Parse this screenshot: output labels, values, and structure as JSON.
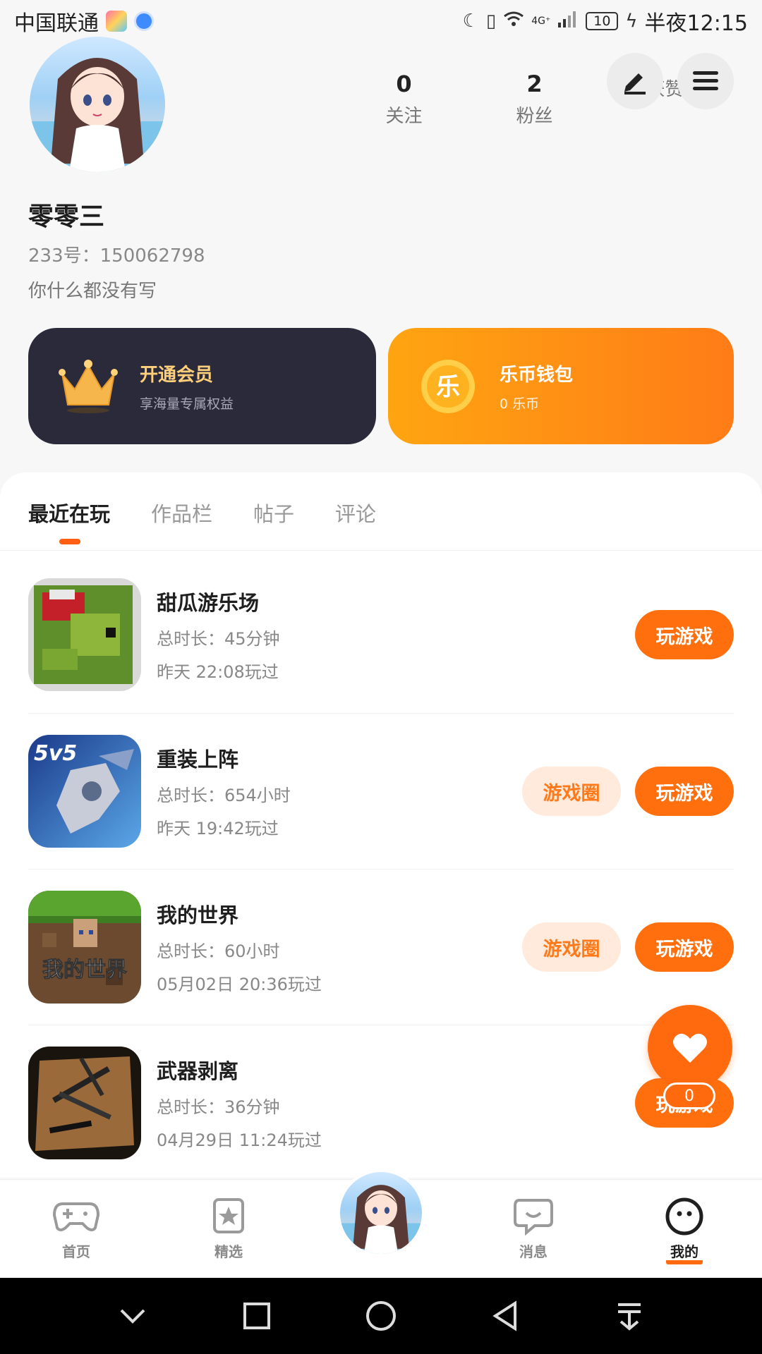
{
  "status_bar": {
    "carrier": "中国联通",
    "network": "4G⁺",
    "battery": "10",
    "time": "半夜12:15"
  },
  "profile": {
    "stats": [
      {
        "value": "0",
        "label": "关注"
      },
      {
        "value": "2",
        "label": "粉丝"
      },
      {
        "value": "",
        "label": "获赞"
      }
    ],
    "nickname": "零零三",
    "user_id": "233号：150062798",
    "bio": "你什么都没有写"
  },
  "cards": {
    "vip": {
      "title": "开通会员",
      "subtitle": "享海量专属权益",
      "icon": "crown-icon"
    },
    "wallet": {
      "title": "乐币钱包",
      "subtitle": "0 乐币",
      "icon_char": "乐"
    }
  },
  "tabs": [
    "最近在玩",
    "作品栏",
    "帖子",
    "评论"
  ],
  "games": [
    {
      "name": "甜瓜游乐场",
      "duration": "总时长：45分钟",
      "last_played": "昨天 22:08玩过",
      "circle_label": "",
      "play_label": "玩游戏"
    },
    {
      "name": "重装上阵",
      "duration": "总时长：654小时",
      "last_played": "昨天 19:42玩过",
      "circle_label": "游戏圈",
      "play_label": "玩游戏"
    },
    {
      "name": "我的世界",
      "duration": "总时长：60小时",
      "last_played": "05月02日 20:36玩过",
      "circle_label": "游戏圈",
      "play_label": "玩游戏"
    },
    {
      "name": "武器剥离",
      "duration": "总时长：36分钟",
      "last_played": "04月29日 11:24玩过",
      "circle_label": "",
      "play_label": "玩游戏"
    }
  ],
  "fab": {
    "count": "0"
  },
  "bottom_nav": [
    {
      "label": "首页",
      "icon": "gamepad-icon"
    },
    {
      "label": "精选",
      "icon": "star-bookmark-icon"
    },
    {
      "label": "消息",
      "icon": "chat-icon"
    },
    {
      "label": "我的",
      "icon": "smile-face-icon"
    }
  ],
  "colors": {
    "accent": "#ff6a0f",
    "vip_bg": "#2b2a3a",
    "wallet_start": "#ffa511",
    "wallet_end": "#ff7c17"
  }
}
